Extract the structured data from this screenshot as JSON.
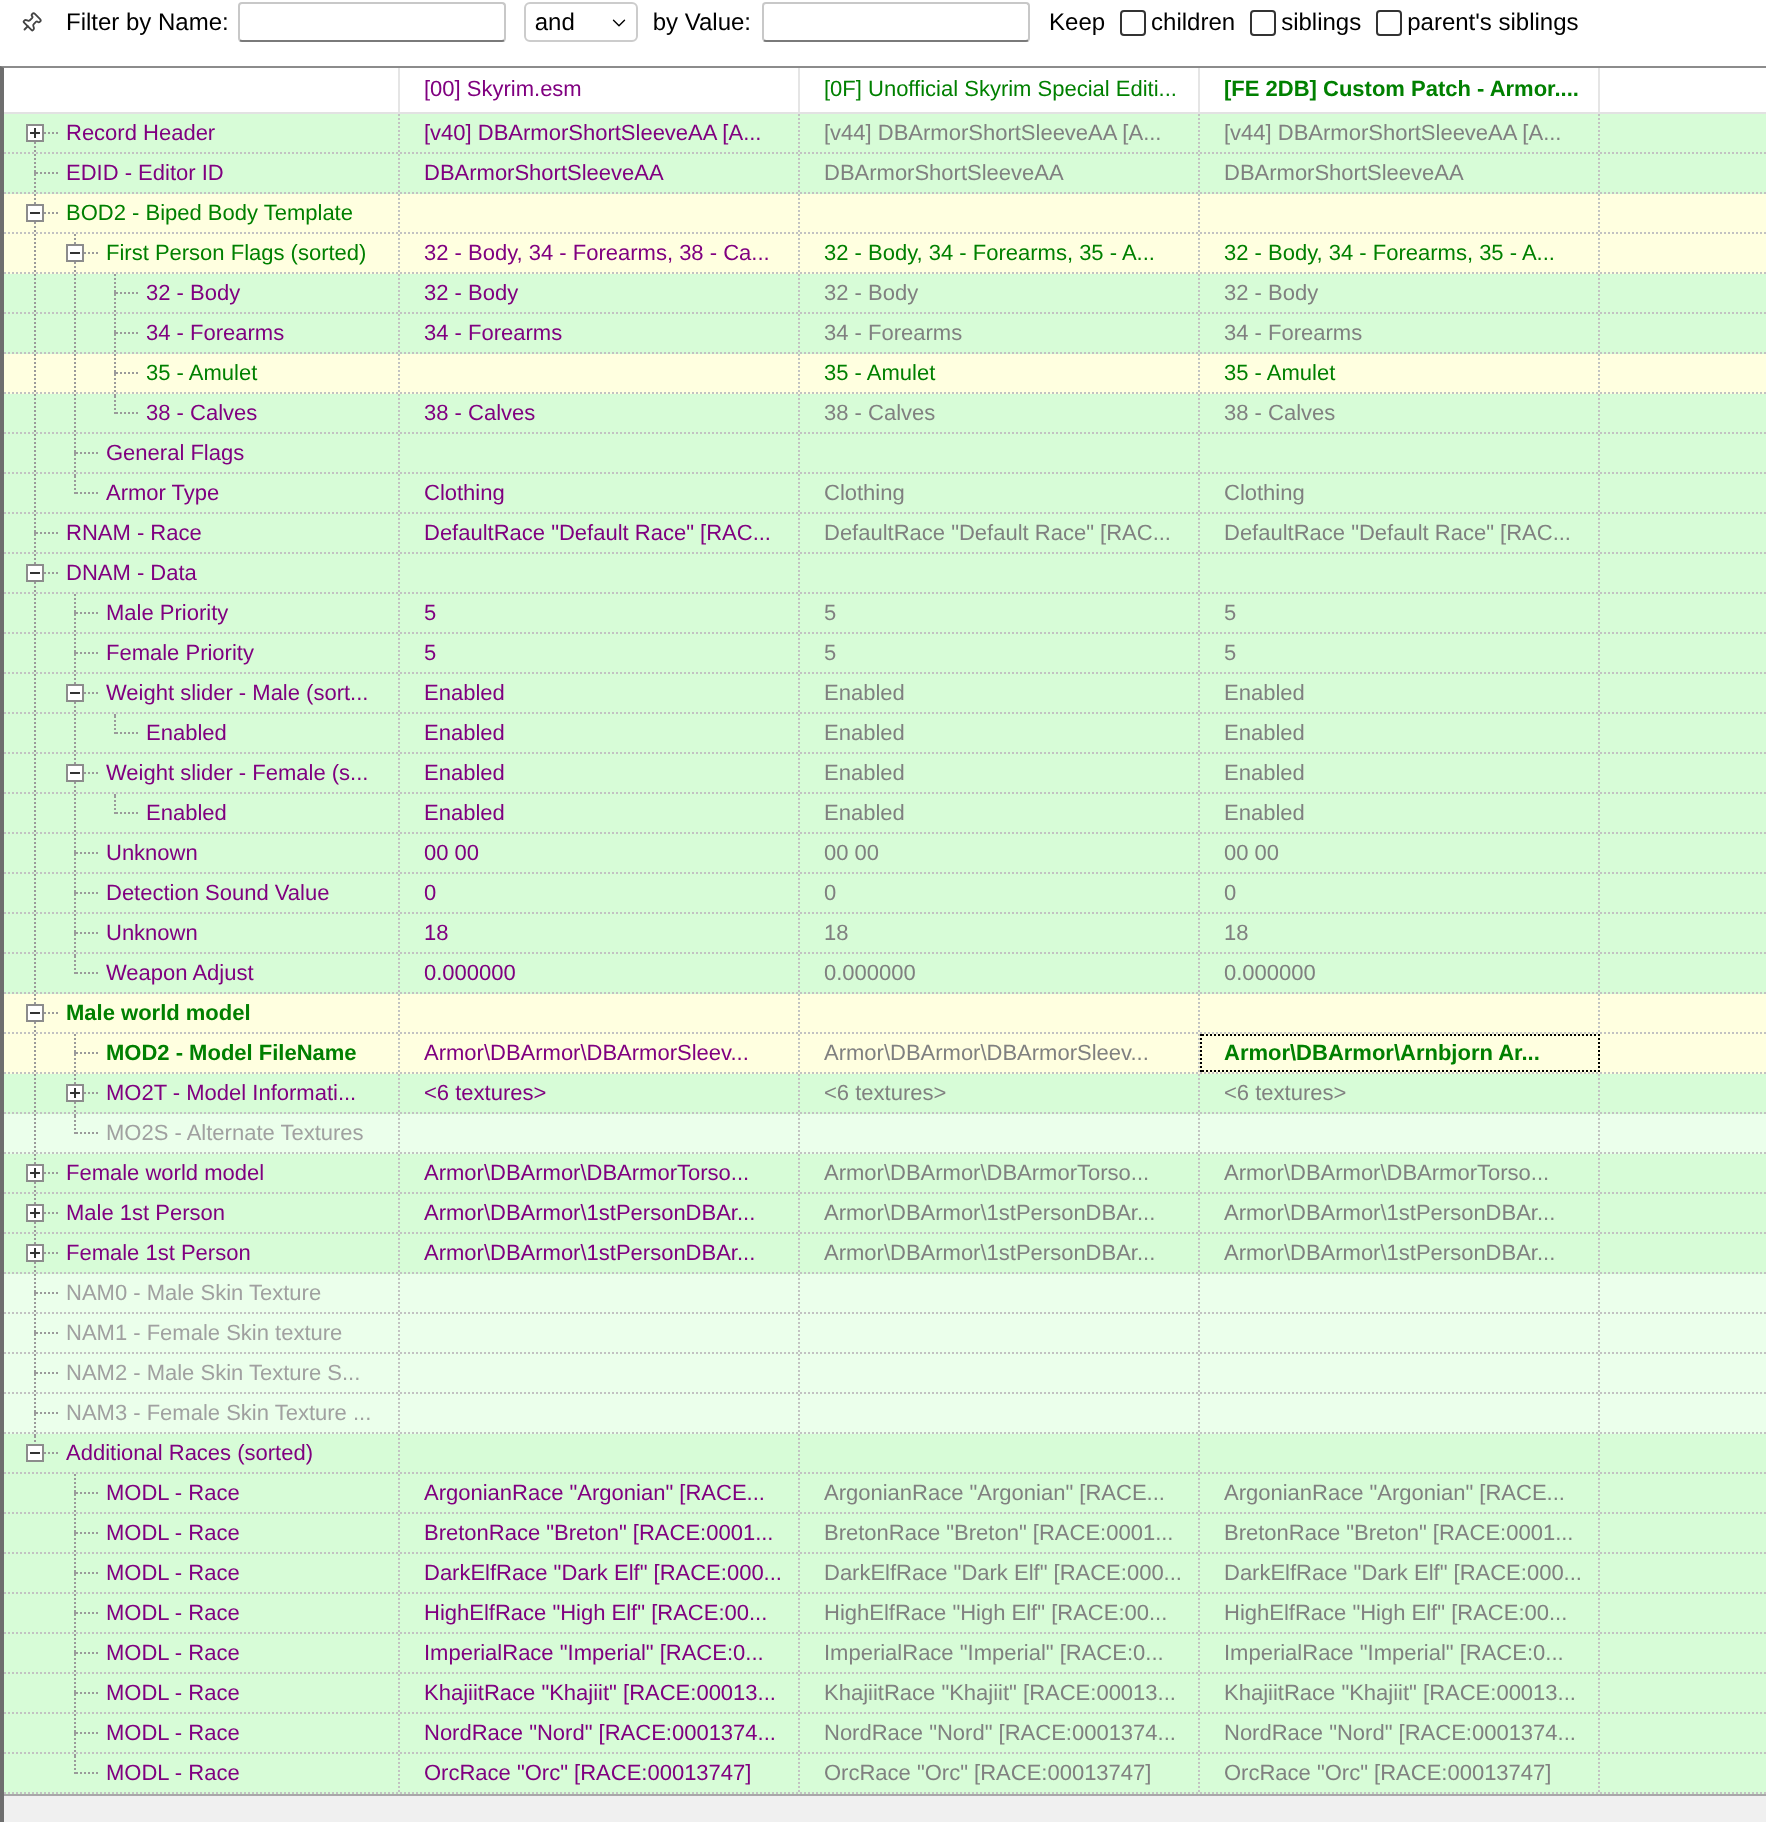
{
  "filter_bar": {
    "name_label": "Filter by Name:",
    "operator": "and",
    "value_label": "by Value:",
    "keep_label": "Keep",
    "keep_options": [
      {
        "label": "children",
        "checked": false
      },
      {
        "label": "siblings",
        "checked": false
      },
      {
        "label": "parent's siblings",
        "checked": false
      }
    ]
  },
  "table": {
    "columns": [
      {
        "text": "[00] Skyrim.esm",
        "kind": "master"
      },
      {
        "text": "[0F] Unofficial Skyrim Special Editi...",
        "kind": "override"
      },
      {
        "text": "[FE 2DB] Custom Patch - Armor....",
        "kind": "winner"
      }
    ],
    "rows": [
      {
        "label": "Record Header",
        "kind": "match",
        "expanded": false,
        "cells": [
          {
            "text": "[v40] DBArmorShortSleeveAA [A...",
            "kind": "master"
          },
          {
            "text": "[v44] DBArmorShortSleeveAA [A...",
            "kind": "identical"
          },
          {
            "text": "[v44] DBArmorShortSleeveAA [A...",
            "kind": "identical"
          }
        ]
      },
      {
        "label": "EDID - Editor ID",
        "kind": "match",
        "cells": [
          {
            "text": "DBArmorShortSleeveAA",
            "kind": "master"
          },
          {
            "text": "DBArmorShortSleeveAA",
            "kind": "identical"
          },
          {
            "text": "DBArmorShortSleeveAA",
            "kind": "identical"
          }
        ]
      },
      {
        "label": "BOD2 - Biped Body Template",
        "kind": "conflict",
        "expanded": true,
        "children": [
          {
            "label": "First Person Flags (sorted)",
            "kind": "conflict",
            "expanded": true,
            "cells": [
              {
                "text": "32 - Body, 34 - Forearms, 38 - Ca...",
                "kind": "master"
              },
              {
                "text": "32 - Body, 34 - Forearms, 35 - A...",
                "kind": "override"
              },
              {
                "text": "32 - Body, 34 - Forearms, 35 - A...",
                "kind": "override"
              }
            ],
            "children": [
              {
                "label": "32 - Body",
                "kind": "match",
                "cells": [
                  {
                    "text": "32 - Body",
                    "kind": "master"
                  },
                  {
                    "text": "32 - Body",
                    "kind": "identical"
                  },
                  {
                    "text": "32 - Body",
                    "kind": "identical"
                  }
                ]
              },
              {
                "label": "34 - Forearms",
                "kind": "match",
                "cells": [
                  {
                    "text": "34 - Forearms",
                    "kind": "master"
                  },
                  {
                    "text": "34 - Forearms",
                    "kind": "identical"
                  },
                  {
                    "text": "34 - Forearms",
                    "kind": "identical"
                  }
                ]
              },
              {
                "label": "35 - Amulet",
                "kind": "conflict",
                "cells": [
                  null,
                  {
                    "text": "35 - Amulet",
                    "kind": "override"
                  },
                  {
                    "text": "35 - Amulet",
                    "kind": "override"
                  }
                ]
              },
              {
                "label": "38 - Calves",
                "kind": "match",
                "cells": [
                  {
                    "text": "38 - Calves",
                    "kind": "master"
                  },
                  {
                    "text": "38 - Calves",
                    "kind": "identical"
                  },
                  {
                    "text": "38 - Calves",
                    "kind": "identical"
                  }
                ]
              }
            ]
          },
          {
            "label": "General Flags",
            "kind": "match"
          },
          {
            "label": "Armor Type",
            "kind": "match",
            "cells": [
              {
                "text": "Clothing",
                "kind": "master"
              },
              {
                "text": "Clothing",
                "kind": "identical"
              },
              {
                "text": "Clothing",
                "kind": "identical"
              }
            ]
          }
        ]
      },
      {
        "label": "RNAM - Race",
        "kind": "match",
        "cells": [
          {
            "text": "DefaultRace \"Default Race\" [RAC...",
            "kind": "master"
          },
          {
            "text": "DefaultRace \"Default Race\" [RAC...",
            "kind": "identical"
          },
          {
            "text": "DefaultRace \"Default Race\" [RAC...",
            "kind": "identical"
          }
        ]
      },
      {
        "label": "DNAM - Data",
        "kind": "match",
        "expanded": true,
        "children": [
          {
            "label": "Male Priority",
            "kind": "match",
            "cells": [
              {
                "text": "5",
                "kind": "master"
              },
              {
                "text": "5",
                "kind": "identical"
              },
              {
                "text": "5",
                "kind": "identical"
              }
            ]
          },
          {
            "label": "Female Priority",
            "kind": "match",
            "cells": [
              {
                "text": "5",
                "kind": "master"
              },
              {
                "text": "5",
                "kind": "identical"
              },
              {
                "text": "5",
                "kind": "identical"
              }
            ]
          },
          {
            "label": "Weight slider - Male (sort...",
            "kind": "match",
            "expanded": true,
            "cells": [
              {
                "text": "Enabled",
                "kind": "master"
              },
              {
                "text": "Enabled",
                "kind": "identical"
              },
              {
                "text": "Enabled",
                "kind": "identical"
              }
            ],
            "children": [
              {
                "label": "Enabled",
                "kind": "match",
                "cells": [
                  {
                    "text": "Enabled",
                    "kind": "master"
                  },
                  {
                    "text": "Enabled",
                    "kind": "identical"
                  },
                  {
                    "text": "Enabled",
                    "kind": "identical"
                  }
                ]
              }
            ]
          },
          {
            "label": "Weight slider - Female (s...",
            "kind": "match",
            "expanded": true,
            "cells": [
              {
                "text": "Enabled",
                "kind": "master"
              },
              {
                "text": "Enabled",
                "kind": "identical"
              },
              {
                "text": "Enabled",
                "kind": "identical"
              }
            ],
            "children": [
              {
                "label": "Enabled",
                "kind": "match",
                "cells": [
                  {
                    "text": "Enabled",
                    "kind": "master"
                  },
                  {
                    "text": "Enabled",
                    "kind": "identical"
                  },
                  {
                    "text": "Enabled",
                    "kind": "identical"
                  }
                ]
              }
            ]
          },
          {
            "label": "Unknown",
            "kind": "match",
            "cells": [
              {
                "text": "00 00",
                "kind": "master"
              },
              {
                "text": "00 00",
                "kind": "identical"
              },
              {
                "text": "00 00",
                "kind": "identical"
              }
            ]
          },
          {
            "label": "Detection Sound Value",
            "kind": "match",
            "cells": [
              {
                "text": "0",
                "kind": "master"
              },
              {
                "text": "0",
                "kind": "identical"
              },
              {
                "text": "0",
                "kind": "identical"
              }
            ]
          },
          {
            "label": "Unknown",
            "kind": "match",
            "cells": [
              {
                "text": "18",
                "kind": "master"
              },
              {
                "text": "18",
                "kind": "identical"
              },
              {
                "text": "18",
                "kind": "identical"
              }
            ]
          },
          {
            "label": "Weapon Adjust",
            "kind": "match",
            "cells": [
              {
                "text": "0.000000",
                "kind": "master"
              },
              {
                "text": "0.000000",
                "kind": "identical"
              },
              {
                "text": "0.000000",
                "kind": "identical"
              }
            ]
          }
        ]
      },
      {
        "label": "Male world model",
        "kind": "conflict",
        "bold": true,
        "expanded": true,
        "children": [
          {
            "label": "MOD2 - Model FileName",
            "kind": "conflict",
            "bold": true,
            "cells": [
              {
                "text": "Armor\\DBArmor\\DBArmorSleev...",
                "kind": "master"
              },
              {
                "text": "Armor\\DBArmor\\DBArmorSleev...",
                "kind": "identical"
              },
              {
                "text": "Armor\\DBArmor\\Arnbjorn Ar...",
                "kind": "winner",
                "focused": true
              }
            ]
          },
          {
            "label": "MO2T - Model Informati...",
            "kind": "match",
            "expanded": false,
            "cells": [
              {
                "text": "<6 textures>",
                "kind": "master"
              },
              {
                "text": "<6 textures>",
                "kind": "identical"
              },
              {
                "text": "<6 textures>",
                "kind": "identical"
              }
            ]
          },
          {
            "label": "MO2S - Alternate Textures",
            "kind": "absent"
          }
        ]
      },
      {
        "label": "Female world model",
        "kind": "match",
        "expanded": false,
        "cells": [
          {
            "text": "Armor\\DBArmor\\DBArmorTorso...",
            "kind": "master"
          },
          {
            "text": "Armor\\DBArmor\\DBArmorTorso...",
            "kind": "identical"
          },
          {
            "text": "Armor\\DBArmor\\DBArmorTorso...",
            "kind": "identical"
          }
        ]
      },
      {
        "label": "Male 1st Person",
        "kind": "match",
        "expanded": false,
        "cells": [
          {
            "text": "Armor\\DBArmor\\1stPersonDBAr...",
            "kind": "master"
          },
          {
            "text": "Armor\\DBArmor\\1stPersonDBAr...",
            "kind": "identical"
          },
          {
            "text": "Armor\\DBArmor\\1stPersonDBAr...",
            "kind": "identical"
          }
        ]
      },
      {
        "label": "Female 1st Person",
        "kind": "match",
        "expanded": false,
        "cells": [
          {
            "text": "Armor\\DBArmor\\1stPersonDBAr...",
            "kind": "master"
          },
          {
            "text": "Armor\\DBArmor\\1stPersonDBAr...",
            "kind": "identical"
          },
          {
            "text": "Armor\\DBArmor\\1stPersonDBAr...",
            "kind": "identical"
          }
        ]
      },
      {
        "label": "NAM0 - Male Skin Texture",
        "kind": "absent"
      },
      {
        "label": "NAM1 - Female Skin texture",
        "kind": "absent"
      },
      {
        "label": "NAM2 - Male Skin Texture S...",
        "kind": "absent"
      },
      {
        "label": "NAM3 - Female Skin Texture ...",
        "kind": "absent"
      },
      {
        "label": "Additional Races (sorted)",
        "kind": "match",
        "expanded": true,
        "children": [
          {
            "label": "MODL - Race",
            "kind": "match",
            "cells": [
              {
                "text": "ArgonianRace \"Argonian\" [RACE...",
                "kind": "master"
              },
              {
                "text": "ArgonianRace \"Argonian\" [RACE...",
                "kind": "identical"
              },
              {
                "text": "ArgonianRace \"Argonian\" [RACE...",
                "kind": "identical"
              }
            ]
          },
          {
            "label": "MODL - Race",
            "kind": "match",
            "cells": [
              {
                "text": "BretonRace \"Breton\" [RACE:0001...",
                "kind": "master"
              },
              {
                "text": "BretonRace \"Breton\" [RACE:0001...",
                "kind": "identical"
              },
              {
                "text": "BretonRace \"Breton\" [RACE:0001...",
                "kind": "identical"
              }
            ]
          },
          {
            "label": "MODL - Race",
            "kind": "match",
            "cells": [
              {
                "text": "DarkElfRace \"Dark Elf\" [RACE:000...",
                "kind": "master"
              },
              {
                "text": "DarkElfRace \"Dark Elf\" [RACE:000...",
                "kind": "identical"
              },
              {
                "text": "DarkElfRace \"Dark Elf\" [RACE:000...",
                "kind": "identical"
              }
            ]
          },
          {
            "label": "MODL - Race",
            "kind": "match",
            "cells": [
              {
                "text": "HighElfRace \"High Elf\" [RACE:00...",
                "kind": "master"
              },
              {
                "text": "HighElfRace \"High Elf\" [RACE:00...",
                "kind": "identical"
              },
              {
                "text": "HighElfRace \"High Elf\" [RACE:00...",
                "kind": "identical"
              }
            ]
          },
          {
            "label": "MODL - Race",
            "kind": "match",
            "cells": [
              {
                "text": "ImperialRace \"Imperial\" [RACE:0...",
                "kind": "master"
              },
              {
                "text": "ImperialRace \"Imperial\" [RACE:0...",
                "kind": "identical"
              },
              {
                "text": "ImperialRace \"Imperial\" [RACE:0...",
                "kind": "identical"
              }
            ]
          },
          {
            "label": "MODL - Race",
            "kind": "match",
            "cells": [
              {
                "text": "KhajiitRace \"Khajiit\" [RACE:00013...",
                "kind": "master"
              },
              {
                "text": "KhajiitRace \"Khajiit\" [RACE:00013...",
                "kind": "identical"
              },
              {
                "text": "KhajiitRace \"Khajiit\" [RACE:00013...",
                "kind": "identical"
              }
            ]
          },
          {
            "label": "MODL - Race",
            "kind": "match",
            "cells": [
              {
                "text": "NordRace \"Nord\" [RACE:0001374...",
                "kind": "master"
              },
              {
                "text": "NordRace \"Nord\" [RACE:0001374...",
                "kind": "identical"
              },
              {
                "text": "NordRace \"Nord\" [RACE:0001374...",
                "kind": "identical"
              }
            ]
          },
          {
            "label": "MODL - Race",
            "kind": "match",
            "cells": [
              {
                "text": "OrcRace \"Orc\" [RACE:00013747]",
                "kind": "master"
              },
              {
                "text": "OrcRace \"Orc\" [RACE:00013747]",
                "kind": "identical"
              },
              {
                "text": "OrcRace \"Orc\" [RACE:00013747]",
                "kind": "identical"
              }
            ]
          }
        ]
      }
    ]
  }
}
